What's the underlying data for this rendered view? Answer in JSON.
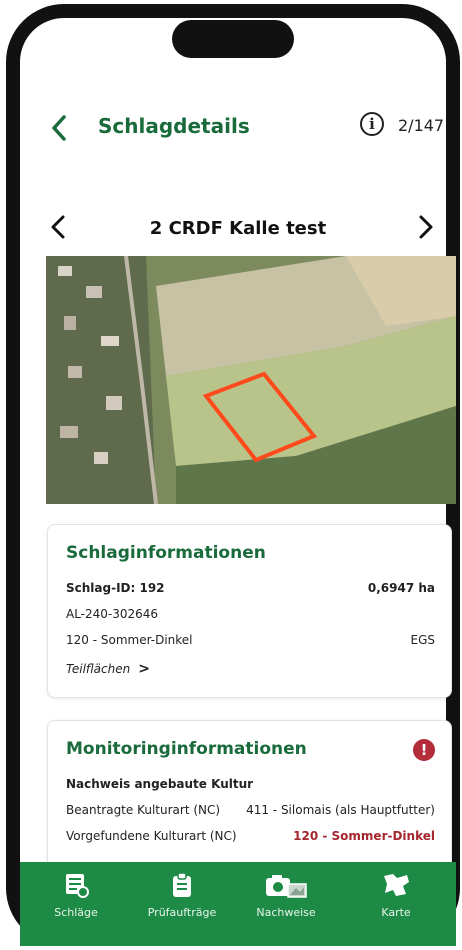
{
  "header": {
    "title": "Schlagdetails",
    "counter": "2/147",
    "info_icon": "info-circle-icon",
    "back_icon": "chevron-left-icon"
  },
  "field_nav": {
    "name": "2 CRDF Kalle test",
    "prev_icon": "chevron-left-icon",
    "next_icon": "chevron-right-icon"
  },
  "schlag_info": {
    "title": "Schlaginformationen",
    "id_label": "Schlag-ID: 192",
    "area": "0,6947 ha",
    "al_number": "AL-240-302646",
    "crop": "120 - Sommer-Dinkel",
    "crop_code": "EGS",
    "teilflaechen": "Teilflächen"
  },
  "monitoring": {
    "title": "Monitoringinformationen",
    "warning_icon": "exclamation-icon",
    "subtitle": "Nachweis angebaute Kultur",
    "requested_label": "Beantragte Kulturart (NC)",
    "requested_value": "411 - Silomais (als Hauptfutter)",
    "found_label": "Vorgefundene Kulturart (NC)",
    "found_value": "120 - Sommer-Dinkel"
  },
  "tabs": [
    {
      "label": "Schläge",
      "icon": "list-icon"
    },
    {
      "label": "Prüfaufträge",
      "icon": "clipboard-icon"
    },
    {
      "label": "Nachweise",
      "icon": "camera-icon"
    },
    {
      "label": "Karte",
      "icon": "map-icon"
    }
  ],
  "colors": {
    "brand_green": "#1d8a46",
    "title_green": "#1a6b3c",
    "alert_red": "#a5262f",
    "field_outline": "#ff4a1c"
  }
}
